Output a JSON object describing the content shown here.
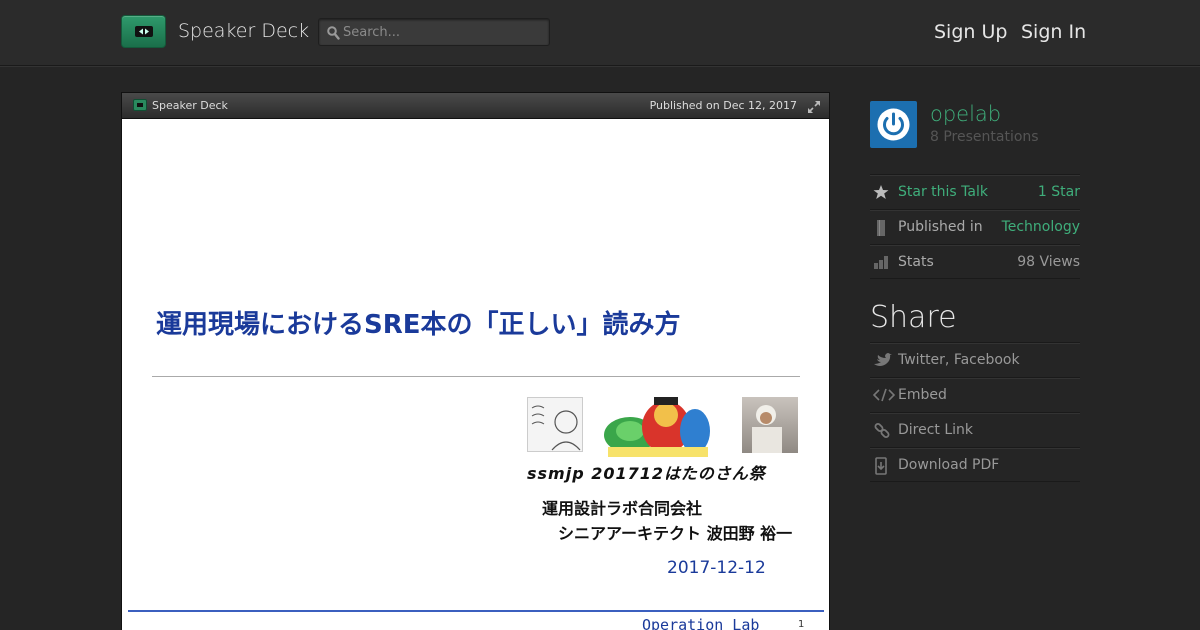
{
  "header": {
    "brand": "Speaker Deck",
    "search_placeholder": "Search...",
    "sign_up": "Sign Up",
    "sign_in": "Sign In"
  },
  "player": {
    "brand": "Speaker Deck",
    "published": "Published on Dec 12, 2017"
  },
  "slide": {
    "title": "運用現場におけるSRE本の「正しい」読み方",
    "event": "ssmjp 201712はたのさん祭",
    "company": "運用設計ラボ合同会社",
    "author": "シニアアーキテクト 波田野 裕一",
    "date": "2017-12-12",
    "footer": "Operation Lab",
    "page_number": "1"
  },
  "sidebar": {
    "username": "opelab",
    "presentations": "8 Presentations",
    "meta": [
      {
        "icon": "star-icon",
        "label": "Star this Talk",
        "value": "1 Star"
      },
      {
        "icon": "bookmark-icon",
        "label": "Published in",
        "value": "Technology"
      },
      {
        "icon": "bar-chart-icon",
        "label": "Stats",
        "value": "98 Views"
      }
    ],
    "share_title": "Share",
    "share": [
      {
        "icon": "bird-icon",
        "label": "Twitter, Facebook"
      },
      {
        "icon": "code-icon",
        "label": "Embed"
      },
      {
        "icon": "link-icon",
        "label": "Direct Link"
      },
      {
        "icon": "download-icon",
        "label": "Download PDF"
      }
    ]
  },
  "colors": {
    "accent_green": "#3fae7b",
    "slide_blue": "#1a3a9a",
    "avatar_blue": "#1c6fb0"
  }
}
